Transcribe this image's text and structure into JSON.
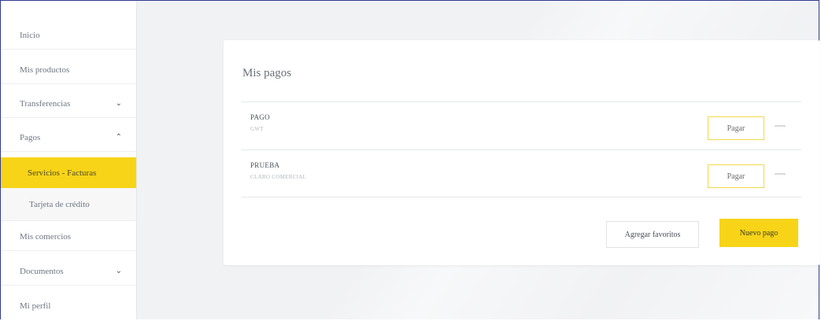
{
  "sidebar": {
    "items": [
      {
        "label": "Inicio",
        "chevron": ""
      },
      {
        "label": "Mis productos",
        "chevron": ""
      },
      {
        "label": "Transferencias",
        "chevron": "⌄"
      },
      {
        "label": "Pagos",
        "chevron": "⌃"
      },
      {
        "label": "Servicios - Facturas",
        "chevron": ""
      },
      {
        "label": "Tarjeta de crédito",
        "chevron": ""
      },
      {
        "label": "Mis comercios",
        "chevron": ""
      },
      {
        "label": "Documentos",
        "chevron": "⌄"
      },
      {
        "label": "Mi perfil",
        "chevron": ""
      }
    ]
  },
  "main": {
    "title": "Mis pagos",
    "payments": [
      {
        "name": "PAGO",
        "detail": "GWT",
        "pay_label": "Pagar"
      },
      {
        "name": "PRUEBA",
        "detail": "CLARO COMERCIAL",
        "pay_label": "Pagar"
      }
    ],
    "favorites_label": "Agregar favoritos",
    "new_payment_label": "Nuevo pago"
  },
  "colors": {
    "accent": "#f7d417",
    "background": "#f1f2f4",
    "frame_border": "#2f3b8f"
  }
}
